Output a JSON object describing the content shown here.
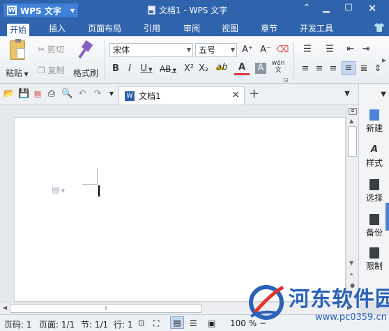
{
  "title_bar": {
    "app_button": "WPS 文字",
    "document_title": "文档1 - WPS 文字"
  },
  "menu": [
    "开始",
    "插入",
    "页面布局",
    "引用",
    "审阅",
    "视图",
    "章节",
    "开发工具"
  ],
  "ribbon": {
    "paste": "粘贴",
    "cut": "剪切",
    "copy": "复制",
    "format_painter": "格式刷",
    "font_name": "宋体",
    "font_size": "五号",
    "grow_font": "A⁺",
    "shrink_font": "A⁻",
    "bold": "B",
    "italic": "I",
    "underline": "U",
    "strikethrough": "AB",
    "superscript": "X²",
    "subscript": "X₂",
    "phonetic": "wén"
  },
  "doc_tab": {
    "name": "文档1",
    "close": "×",
    "new_tab": "+"
  },
  "right_panel": {
    "items": [
      "新建",
      "样式",
      "选择",
      "备份",
      "限制"
    ]
  },
  "status_bar": {
    "page_num": "页码: 1",
    "pages": "页面: 1/1",
    "section": "节: 1/1",
    "line": "行: 1",
    "zoom": "100 %"
  },
  "watermark": {
    "name": "河东软件园",
    "url": "www.pc0359.cn"
  },
  "colors": {
    "title_bg": "#2f64ad",
    "accent": "#3f80d8",
    "panel_icon": "#4d83d6",
    "watermark_text": "#2a62b8"
  }
}
